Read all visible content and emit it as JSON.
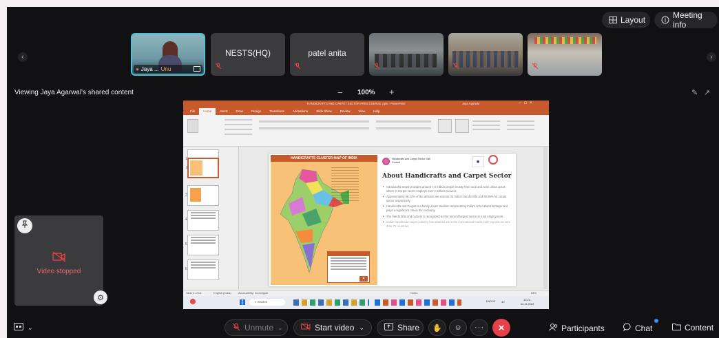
{
  "top": {
    "layout_label": "Layout",
    "meeting_info_label": "Meeting info"
  },
  "participants": [
    {
      "name": "Jaya ...",
      "badge": "Unu",
      "kind": "video"
    },
    {
      "name": "NESTS(HQ)",
      "kind": "name"
    },
    {
      "name": "patel anita",
      "kind": "name"
    },
    {
      "name": "",
      "kind": "video"
    },
    {
      "name": "",
      "kind": "video"
    },
    {
      "name": "",
      "kind": "video"
    }
  ],
  "share": {
    "viewing_label": "Viewing Jaya Agarwal's shared content",
    "zoom": "100%",
    "zoom_out": "−",
    "zoom_in": "+"
  },
  "self_view": {
    "status": "Video stopped"
  },
  "ppt": {
    "title": "HANDICRAFTS AND CARPET SECTOR PRES CSERVE .pptx - PowerPoint",
    "user": "Jaya Agarwal",
    "menu": [
      "File",
      "Home",
      "Insert",
      "Draw",
      "Design",
      "Transitions",
      "Animations",
      "Slide Show",
      "Review",
      "View",
      "Help"
    ],
    "map_title": "HANDICRAFTS CLUSTER MAP OF INDIA",
    "slide_heading": "About Handicrafts and Carpet Sector",
    "logo_text": "Handicrafts and Carpet Sector Skill Council",
    "bullets": [
      "Handicrafts sector provides around 7.0 million people mostly from rural and semi urban areas where in Carpet sector employs over 2 million weavers.",
      "Approximately 56.13% of the artisans are women for India's handicrafts and 68.86% for carpet sector respectively.",
      "Handicrafts and Carpet is a family driven tradition representing India's rich cultural heritage and plays a significant role in the economy.",
      "The handicrafts and carpets is recognized as the second largest sector in rural employment.",
      "Indian handmade carpet industry has attained 1st in the international market with exports to more than 70 countries."
    ],
    "status_left": "Slide 2 of 15",
    "status_lang": "English (India)",
    "accessibility": "Accessibility: Investigate",
    "notes": "Notes",
    "zoom_status": "68%",
    "taskbar_search": "Search",
    "time": "10:23",
    "date": "02-11-2023",
    "lang": "ENG IN",
    "weather": "40"
  },
  "bottom": {
    "unmute": "Unmute",
    "start_video": "Start video",
    "share": "Share",
    "participants": "Participants",
    "chat": "Chat",
    "content": "Content"
  },
  "colors": {
    "accent_red": "#e5414a",
    "ppt_orange": "#c65a2c",
    "map_panel": "#f7c277"
  }
}
